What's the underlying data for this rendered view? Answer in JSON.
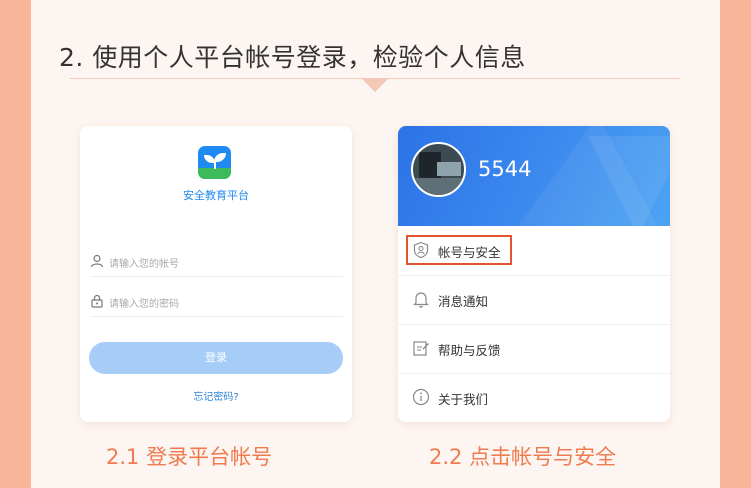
{
  "step": {
    "title": "2. 使用个人平台帐号登录，检验个人信息"
  },
  "login": {
    "brand": "安全教育平台",
    "username_placeholder": "请输入您的帐号",
    "password_placeholder": "请输入您的密码",
    "login_button": "登录",
    "forgot_link": "忘记密码?"
  },
  "profile": {
    "username": "5544",
    "menu": [
      {
        "label": "帐号与安全",
        "icon": "shield-user-icon"
      },
      {
        "label": "消息通知",
        "icon": "bell-icon"
      },
      {
        "label": "帮助与反馈",
        "icon": "edit-note-icon"
      },
      {
        "label": "关于我们",
        "icon": "info-icon"
      }
    ]
  },
  "captions": {
    "left": "2.1 登录平台帐号",
    "right": "2.2 点击帐号与安全"
  },
  "colors": {
    "outer_background": "#f7b59a",
    "panel_background": "#fdf5f1",
    "caption": "#ef7b4f",
    "highlight": "#e0542f",
    "brand_blue": "#1f8bf0",
    "login_button": "#a6cdf7"
  }
}
